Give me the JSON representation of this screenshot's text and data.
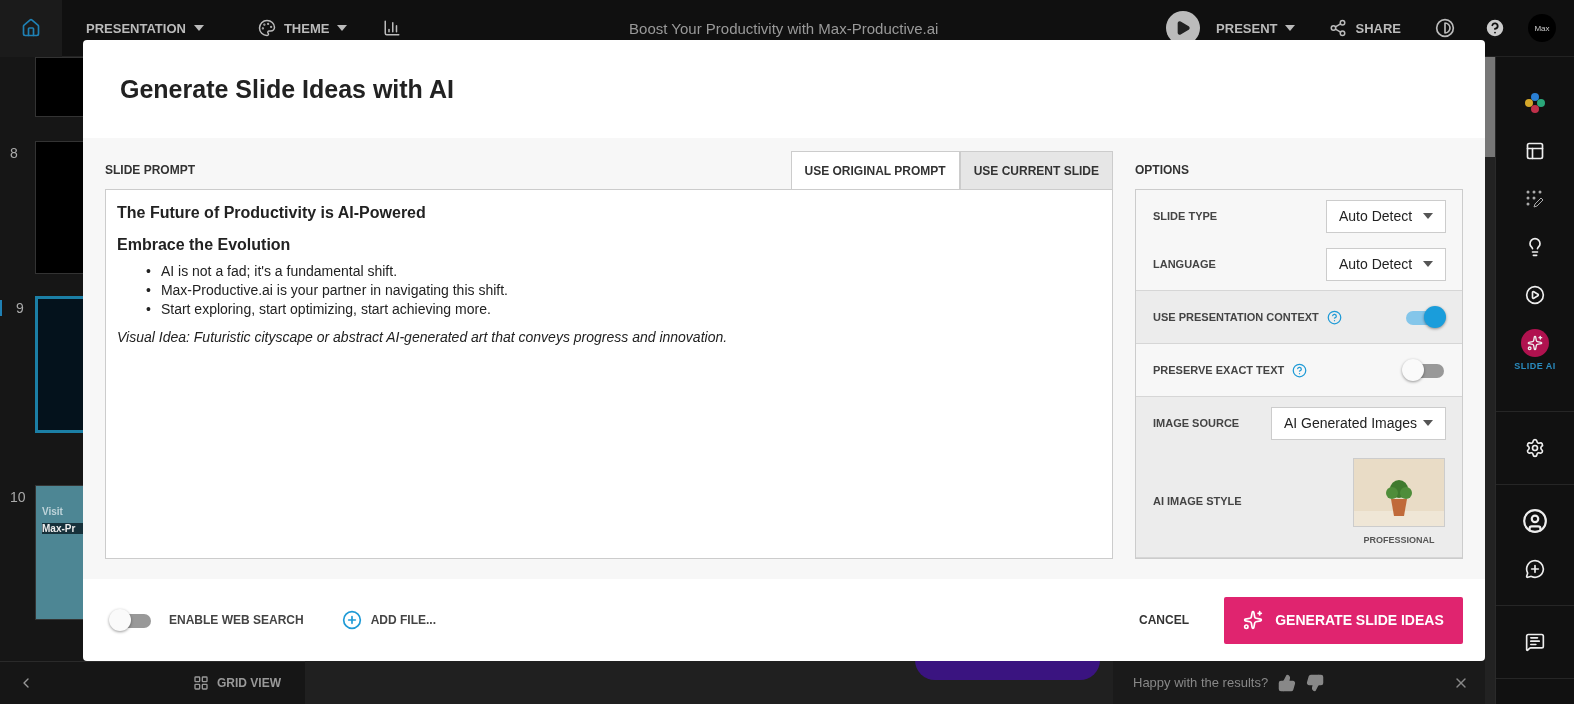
{
  "topbar": {
    "menus": [
      {
        "kind": "dropdown",
        "label": "PRESENTATION"
      },
      {
        "kind": "theme",
        "label": "THEME"
      },
      {
        "kind": "chart"
      }
    ],
    "title": "Boost Your Productivity with Max-Productive.ai",
    "present": "PRESENT",
    "share": "SHARE",
    "avatar": "Max"
  },
  "slides": [
    {
      "number": "8",
      "selected": false
    },
    {
      "number": "9",
      "selected": true
    },
    {
      "number": "10",
      "selected": false,
      "texts": [
        "Visit",
        "Max-Pr"
      ]
    }
  ],
  "grid_view": "GRID VIEW",
  "feedback": {
    "question": "Happy with the results?"
  },
  "rail": [
    [
      {
        "kind": "colors",
        "selected": false
      },
      {
        "kind": "layout",
        "selected": false
      },
      {
        "kind": "dots-pencil",
        "selected": false
      },
      {
        "kind": "bulb",
        "selected": false
      },
      {
        "kind": "play",
        "selected": false
      },
      {
        "kind": "sparkles",
        "selected": true,
        "label": "SLIDE AI"
      }
    ],
    [
      {
        "kind": "gear",
        "selected": false
      }
    ],
    [
      {
        "kind": "person",
        "selected": false
      },
      {
        "kind": "chat-plus",
        "selected": false
      }
    ],
    [
      {
        "kind": "chat-list",
        "selected": false
      }
    ]
  ],
  "modal": {
    "title": "Generate Slide Ideas with AI",
    "prompt_label": "SLIDE PROMPT",
    "prompt_tabs": [
      {
        "label": "USE ORIGINAL PROMPT",
        "selected": true
      },
      {
        "label": "USE CURRENT SLIDE",
        "selected": false
      }
    ],
    "prompt": {
      "heading": "The Future of Productivity is AI-Powered",
      "subheading": "Embrace the Evolution",
      "bullet_marker": "•",
      "bullets": [
        "AI is not a fad; it's a fundamental shift.",
        "Max-Productive.ai is your partner in navigating this shift.",
        "Start exploring, start optimizing, start achieving more."
      ],
      "note": "Visual Idea: Futuristic cityscape or abstract AI-generated art that conveys progress and innovation."
    },
    "options_label": "OPTIONS",
    "option_groups": [
      {
        "rows": [
          {
            "kind": "select",
            "label": "SLIDE TYPE",
            "value": "Auto Detect"
          },
          {
            "kind": "select",
            "label": "LANGUAGE",
            "value": "Auto Detect"
          }
        ]
      },
      {
        "rows": [
          {
            "kind": "toggle",
            "label": "USE PRESENTATION CONTEXT",
            "help": true,
            "on": true
          }
        ]
      },
      {
        "rows": [
          {
            "kind": "toggle",
            "label": "PRESERVE EXACT TEXT",
            "help": true,
            "on": false
          }
        ]
      },
      {
        "rows": [
          {
            "kind": "select",
            "label": "IMAGE SOURCE",
            "value": "AI Generated Images",
            "wide": true
          },
          {
            "kind": "image",
            "label": "AI IMAGE STYLE",
            "caption": "PROFESSIONAL"
          }
        ]
      }
    ],
    "web_search": {
      "label": "ENABLE WEB SEARCH",
      "on": false
    },
    "add_file": "ADD FILE...",
    "cancel": "CANCEL",
    "generate": "GENERATE SLIDE IDEAS"
  }
}
